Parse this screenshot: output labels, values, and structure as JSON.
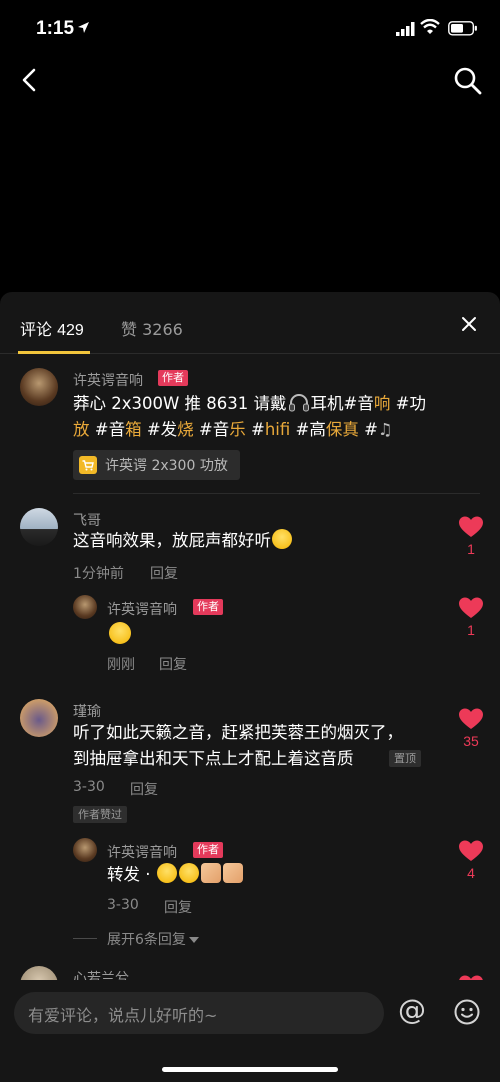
{
  "status": {
    "time": "1:15"
  },
  "tabs": {
    "comments_label": "评论",
    "comments_count": "429",
    "likes_label": "赞",
    "likes_count": "3266"
  },
  "author_post": {
    "name": "许英谔音响",
    "badge": "作者",
    "line1_a": "莽心 2x300W 推 8631 请戴",
    "line1_b": "耳机#音",
    "line1_c": "响",
    "line1_d": " #功",
    "line2_a": "放",
    "line2_b": " #音",
    "line2_c": "箱",
    "line2_d": " #发",
    "line2_e": "烧",
    "line2_f": " #音",
    "line2_g": "乐",
    "line2_h": " #",
    "line2_i": "hifi",
    "line2_j": " #高",
    "line2_k": "保",
    "line2_l": "真",
    "line2_m": " #",
    "product": "许英谔 2x300 功放"
  },
  "comments": [
    {
      "name": "飞哥",
      "text": "这音响效果，放屁声都好听",
      "time": "1分钟前",
      "reply": "回复",
      "likes": "1",
      "sub": {
        "name": "许英谔音响",
        "badge": "作者",
        "time": "刚刚",
        "reply": "回复",
        "likes": "1"
      }
    },
    {
      "name": "瑾瑜",
      "text1": "听了如此天籁之音，赶紧把芙蓉王的烟灭了，",
      "text2": "到抽屉拿出和天下点上才配上着这音质",
      "pin": "置顶",
      "time": "3-30",
      "reply": "回复",
      "author_liked": "作者赞过",
      "likes": "35",
      "sub": {
        "name": "许英谔音响",
        "badge": "作者",
        "text": "转发 · ",
        "time": "3-30",
        "reply": "回复",
        "likes": "4"
      },
      "expand": "展开6条回复"
    },
    {
      "name": "心若兰兮"
    }
  ],
  "input": {
    "placeholder": "有爱评论，说点儿好听的~",
    "at": "@"
  }
}
